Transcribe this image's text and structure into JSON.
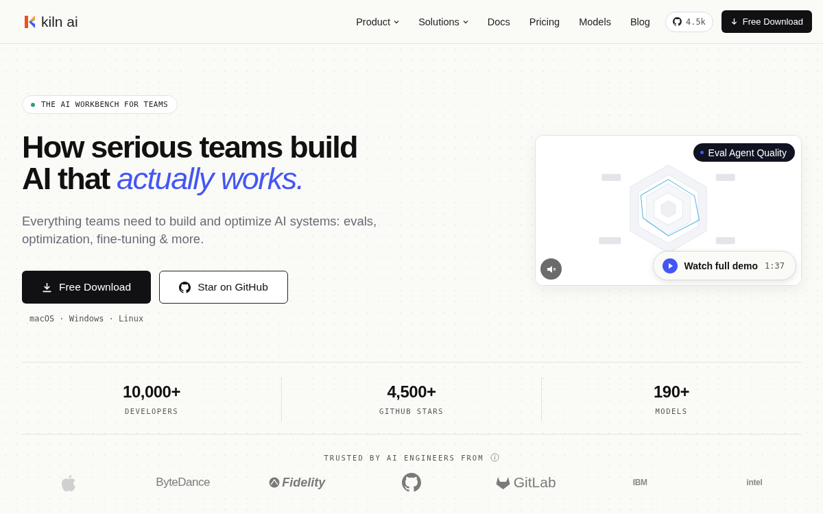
{
  "nav": {
    "brand": "kiln ai",
    "links": [
      {
        "label": "Product",
        "dropdown": true
      },
      {
        "label": "Solutions",
        "dropdown": true
      },
      {
        "label": "Docs",
        "dropdown": false
      },
      {
        "label": "Pricing",
        "dropdown": false
      },
      {
        "label": "Models",
        "dropdown": false
      },
      {
        "label": "Blog",
        "dropdown": false
      }
    ],
    "github_stars": "4.5k",
    "download": "Free Download"
  },
  "hero": {
    "badge": "THE AI WORKBENCH FOR TEAMS",
    "title_lines": [
      "How serious teams build",
      "AI that *actually works.*"
    ],
    "subtitle": "Everything teams need to build and optimize AI systems: evals, optimization, fine-tuning & more.",
    "primary_button": "Free Download",
    "secondary_button": "Star on GitHub",
    "platforms": "macOS · Windows · Linux"
  },
  "demo": {
    "kind": "picture",
    "chip": "Eval Agent Quality",
    "muted": true,
    "watch_label": "Watch full demo",
    "duration": "1:37"
  },
  "stats": [
    {
      "value": "10,000+",
      "label": "DEVELOPERS"
    },
    {
      "value": "4,500+",
      "label": "GITHUB STARS"
    },
    {
      "value": "190+",
      "label": "MODELS"
    }
  ],
  "trusted": {
    "heading": "TRUSTED BY AI ENGINEERS FROM",
    "logos": [
      {
        "kind": "apple"
      },
      {
        "kind": "wordmark",
        "text": "ByteDance"
      },
      {
        "kind": "fidelity",
        "text": "Fidelity"
      },
      {
        "kind": "github"
      },
      {
        "kind": "gitlab",
        "text": "GitLab"
      },
      {
        "kind": "small",
        "text": "IBM"
      },
      {
        "kind": "small",
        "text": "intel"
      }
    ]
  }
}
